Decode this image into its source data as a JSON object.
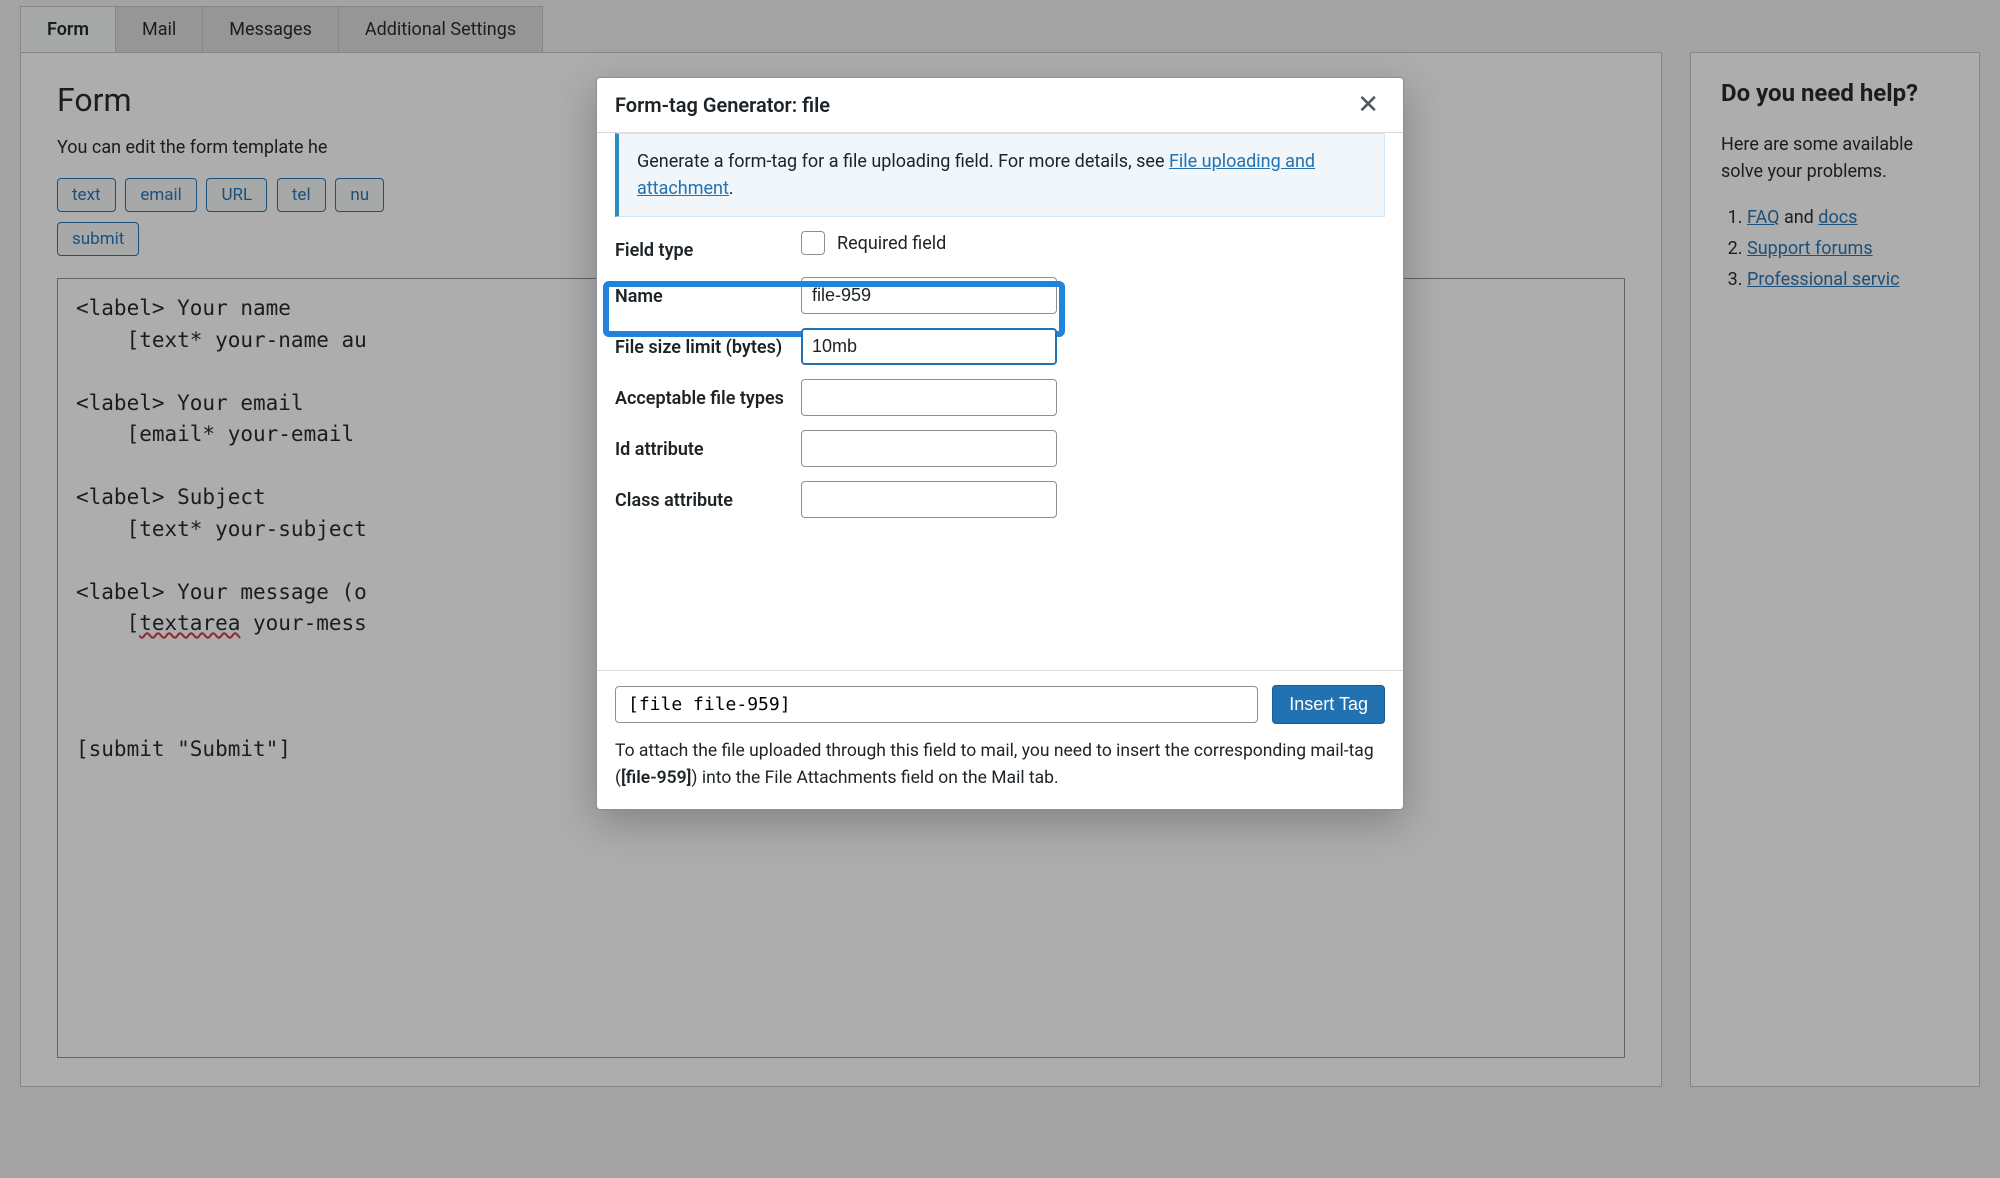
{
  "tabs": {
    "items": [
      {
        "label": "Form",
        "active": true
      },
      {
        "label": "Mail",
        "active": false
      },
      {
        "label": "Messages",
        "active": false
      },
      {
        "label": "Additional Settings",
        "active": false
      }
    ]
  },
  "form_panel": {
    "title": "Form",
    "description": "You can edit the form template he",
    "tag_buttons_row1": [
      "text",
      "email",
      "URL",
      "tel",
      "nu"
    ],
    "tag_buttons_row2": [
      "submit"
    ],
    "editor_text": "<label> Your name\n    [text* your-name au\n\n<label> Your email\n    [email* your-email \n\n<label> Subject\n    [text* your-subject\n\n<label> Your message (o\n    [textarea your-mess\n\n\n\n[submit \"Submit\"]"
  },
  "help": {
    "title": "Do you need help?",
    "description": "Here are some available solve your problems.",
    "links": {
      "faq": "FAQ",
      "and": " and ",
      "docs": "docs",
      "support": "Support forums",
      "pro": "Professional servic"
    }
  },
  "modal": {
    "title": "Form-tag Generator: file",
    "info_text_a": "Generate a form-tag for a file uploading field. For more details, see ",
    "info_link": "File uploading and attachment",
    "info_text_b": ".",
    "fields": {
      "field_type_label": "Field type",
      "required_label": "Required field",
      "name_label": "Name",
      "name_value": "file-959",
      "limit_label": "File size limit (bytes)",
      "limit_value": "10mb",
      "types_label": "Acceptable file types",
      "types_value": "",
      "id_label": "Id attribute",
      "id_value": "",
      "class_label": "Class attribute",
      "class_value": ""
    },
    "output_tag": "[file file-959]",
    "insert_label": "Insert Tag",
    "footer_note_a": "To attach the file uploaded through this field to mail, you need to insert the corresponding mail-tag (",
    "footer_note_tag": "[file-959]",
    "footer_note_b": ") into the File Attachments field on the Mail tab."
  }
}
